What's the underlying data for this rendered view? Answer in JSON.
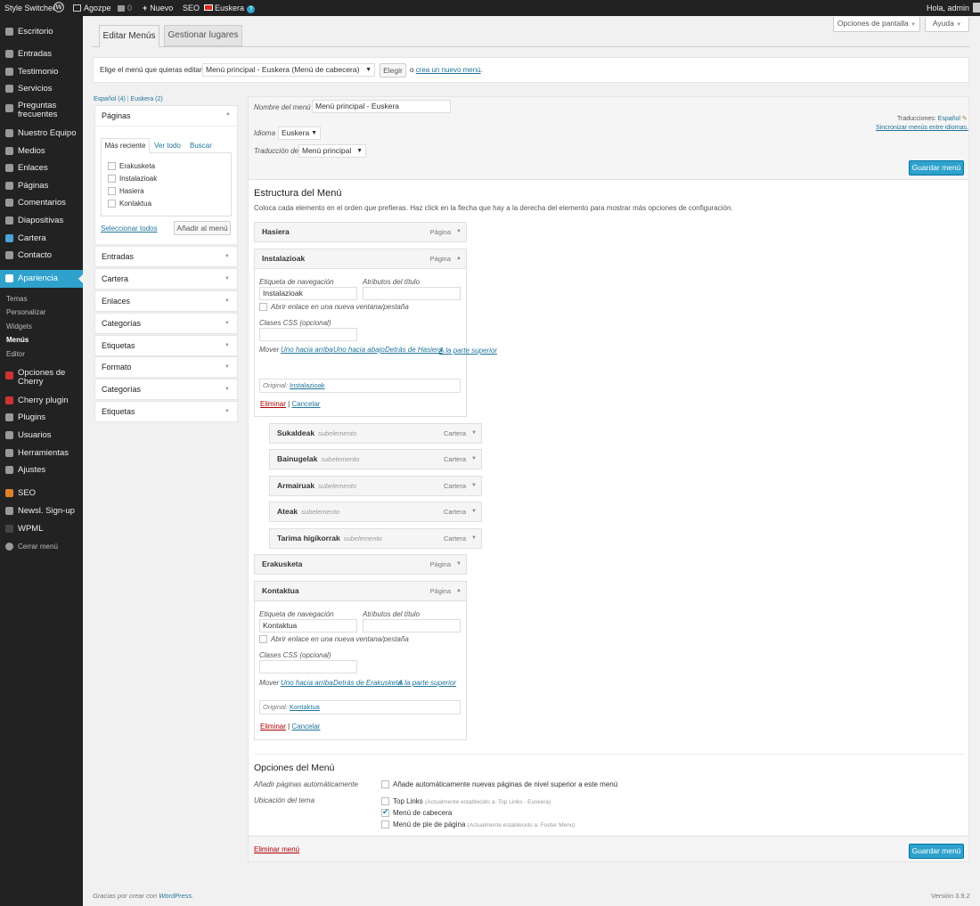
{
  "adminbar": {
    "style_switcher": "Style Switcher",
    "site": "Agozpe",
    "comments": "0",
    "new": "Nuevo",
    "seo": "SEO",
    "lang": "Euskera",
    "greeting": "Hola, admin"
  },
  "sidebar": {
    "items": [
      {
        "label": "Escritorio"
      },
      {
        "label": "Entradas"
      },
      {
        "label": "Testimonio"
      },
      {
        "label": "Servicios"
      },
      {
        "label": "Preguntas frecuentes"
      },
      {
        "label": "Nuestro Equipo"
      },
      {
        "label": "Medios"
      },
      {
        "label": "Enlaces"
      },
      {
        "label": "Páginas"
      },
      {
        "label": "Comentarios"
      },
      {
        "label": "Diapositivas"
      },
      {
        "label": "Cartera"
      },
      {
        "label": "Contacto"
      },
      {
        "label": "Apariencia"
      },
      {
        "label": "Opciones de Cherry"
      },
      {
        "label": "Cherry plugin"
      },
      {
        "label": "Plugins"
      },
      {
        "label": "Usuarios"
      },
      {
        "label": "Herramientas"
      },
      {
        "label": "Ajustes"
      },
      {
        "label": "SEO"
      },
      {
        "label": "Newsl. Sign-up"
      },
      {
        "label": "WPML"
      },
      {
        "label": "Cerrar menú"
      }
    ],
    "submenu": [
      "Temas",
      "Personalizar",
      "Widgets",
      "Menús",
      "Editor"
    ]
  },
  "screen_options": "Opciones de pantalla",
  "help": "Ayuda",
  "tabs": {
    "edit": "Editar Menús",
    "locations": "Gestionar lugares"
  },
  "select_bar": {
    "label": "Elige el menú que quieras editar:",
    "selected": "Menú principal - Euskera (Menú de cabecera)",
    "choose": "Elegir",
    "or": "o",
    "create": "crea un nuevo menú",
    "dot": "."
  },
  "langs": {
    "es": "Español (4)",
    "sep": "|",
    "eu": "Euskera (2)"
  },
  "pages_box": {
    "title": "Páginas",
    "tabs": [
      "Más reciente",
      "Ver todo",
      "Buscar"
    ],
    "items": [
      "Erakusketa",
      "Instalazioak",
      "Hasiera",
      "Kontaktua"
    ],
    "select_all": "Seleccionar todos",
    "add": "Añadir al menú"
  },
  "accordions": [
    "Entradas",
    "Cartera",
    "Enlaces",
    "Categorías",
    "Etiquetas",
    "Formato",
    "Categorías",
    "Etiquetas"
  ],
  "header": {
    "name_label": "Nombre del menú",
    "name_value": "Menú principal - Euskera",
    "lang_label": "Idioma",
    "lang_value": "Euskera",
    "trans_label": "Traducción de:",
    "trans_value": "Menú principal",
    "translations": "Traducciones:",
    "translations_lang": "Español",
    "sync": "Sincronizar menús entre idiomas.",
    "save": "Guardar menú"
  },
  "structure": {
    "title": "Estructura del Menú",
    "desc": "Coloca cada elemento en el orden que prefieras. Haz click en la flecha que hay a la derecha del elemento para mostrar más opciones de configuración."
  },
  "item_labels": {
    "nav_label": "Etiqueta de navegación",
    "title_attr": "Atributos del título",
    "new_window": "Abrir enlace en una nueva ventana/pestaña",
    "css": "Clases CSS (opcional)",
    "move": "Mover",
    "original": "Original:",
    "remove": "Eliminar",
    "pipe": "|",
    "cancel": "Cancelar",
    "page": "Página",
    "cartera": "Cartera",
    "subitem": "subelemento"
  },
  "menu_items": {
    "hasiera": "Hasiera",
    "instalazioak": {
      "title": "Instalazioak",
      "value": "Instalazioak",
      "moves": [
        "Uno hacia arriba",
        "Uno hacia abajo",
        "Detrás de Hasiera",
        "A la parte superior"
      ],
      "original": "Instalazioak"
    },
    "subitems": [
      "Sukaldeak",
      "Bainugelak",
      "Armairuak",
      "Ateak",
      "Tarima higikorrak"
    ],
    "erakusketa": "Erakusketa",
    "kontaktua": {
      "title": "Kontaktua",
      "value": "Kontaktua",
      "moves": [
        "Uno hacia arriba",
        "Detrás de Erakusketa",
        "A la parte superior"
      ],
      "original": "Kontaktua"
    }
  },
  "options": {
    "title": "Opciones del Menú",
    "auto_label": "Añadir páginas automáticamente",
    "auto_text": "Añade automáticamente nuevas páginas de nivel superior a este menú",
    "loc_label": "Ubicación del tema",
    "loc1": "Top Links",
    "loc1_note": "(Actualmente establecido a: Top Links - Euskera)",
    "loc2": "Menú de cabecera",
    "loc3": "Menú de pie de página",
    "loc3_note": "(Actualmente establecido a: Footer Menu)"
  },
  "footer": {
    "delete": "Eliminar menú",
    "save": "Guardar menú",
    "thanks": "Gracias por crear con",
    "wp": "WordPress",
    "dot": ".",
    "version": "Versión 3.9.2"
  }
}
